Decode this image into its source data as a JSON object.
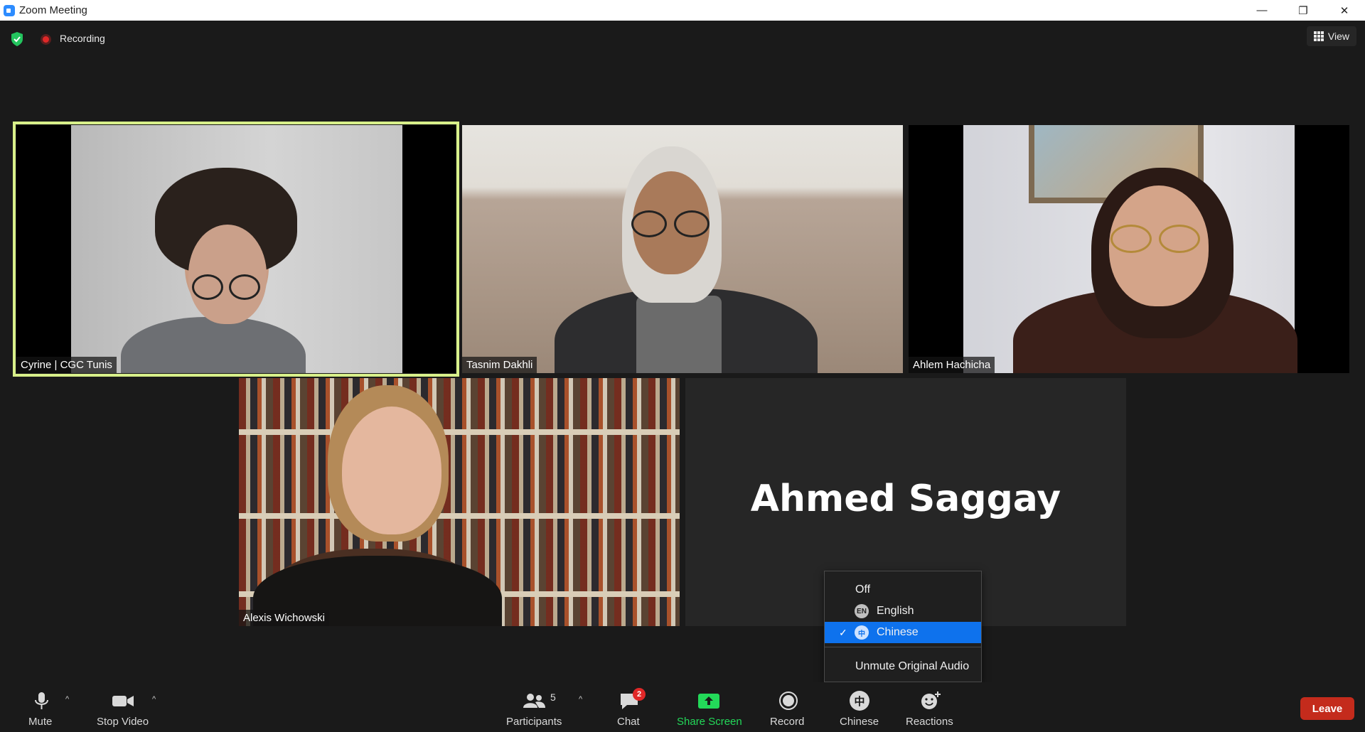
{
  "window": {
    "title": "Zoom Meeting",
    "controls": {
      "minimize": "—",
      "restore": "❐",
      "close": "✕"
    }
  },
  "topbar": {
    "recording_label": "Recording",
    "view_label": "View"
  },
  "participants": [
    {
      "name": "Cyrine | CGC Tunis",
      "active_speaker": true
    },
    {
      "name": "Tasnim Dakhli"
    },
    {
      "name": "Ahlem Hachicha"
    },
    {
      "name": "Alexis Wichowski"
    },
    {
      "name": "Ahmed Saggay",
      "video": "off"
    }
  ],
  "interpretation_menu": {
    "items": [
      {
        "label": "Off"
      },
      {
        "label": "English",
        "badge": "EN"
      },
      {
        "label": "Chinese",
        "badge": "中",
        "selected": true,
        "check": "✓"
      },
      {
        "label": "Unmute Original Audio"
      }
    ]
  },
  "toolbar": {
    "mute": "Mute",
    "stop_video": "Stop Video",
    "participants": "Participants",
    "participants_count": "5",
    "chat": "Chat",
    "chat_badge": "2",
    "share_screen": "Share Screen",
    "record": "Record",
    "interpretation": "Chinese",
    "interpretation_icon": "中",
    "reactions": "Reactions",
    "leave": "Leave",
    "caret": "^"
  },
  "colors": {
    "active_speaker_border": "#d8f08a",
    "share_screen_green": "#23d959",
    "leave_red": "#c42b1c",
    "menu_selected": "#0e72ed",
    "badge_red": "#e02828"
  }
}
